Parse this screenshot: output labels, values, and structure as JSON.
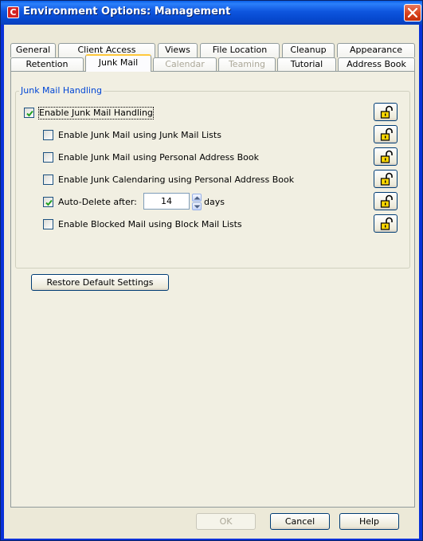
{
  "window": {
    "title": "Environment Options: Management",
    "app_icon_letter": "C"
  },
  "tabs": {
    "row1": [
      {
        "label": "General"
      },
      {
        "label": "Client Access"
      },
      {
        "label": "Views"
      },
      {
        "label": "File Location"
      },
      {
        "label": "Cleanup"
      },
      {
        "label": "Appearance"
      }
    ],
    "row2": [
      {
        "label": "Retention"
      },
      {
        "label": "Junk Mail",
        "selected": true
      },
      {
        "label": "Calendar",
        "disabled": true
      },
      {
        "label": "Teaming",
        "disabled": true
      },
      {
        "label": "Tutorial"
      },
      {
        "label": "Address Book"
      }
    ]
  },
  "junk_mail": {
    "group_title": "Junk Mail Handling",
    "options": [
      {
        "label": "Enable Junk Mail Handling",
        "checked": true
      },
      {
        "label": "Enable Junk Mail using Junk Mail Lists",
        "checked": false
      },
      {
        "label": "Enable Junk Mail using Personal Address Book",
        "checked": false
      },
      {
        "label": "Enable Junk Calendaring using Personal Address Book",
        "checked": false
      },
      {
        "label": "Auto-Delete after:",
        "checked": true
      },
      {
        "label": "Enable Blocked Mail using Block Mail Lists",
        "checked": false
      }
    ],
    "auto_delete_value": "14",
    "auto_delete_unit": "days",
    "lock_icon": "unlocked-padlock-icon"
  },
  "buttons": {
    "restore": "Restore Default Settings",
    "ok": "OK",
    "cancel": "Cancel",
    "help": "Help"
  },
  "colors": {
    "title_bar": "#0a5fe8",
    "group_title": "#0046d5",
    "selected_tab_accent": "#ffc83c"
  }
}
